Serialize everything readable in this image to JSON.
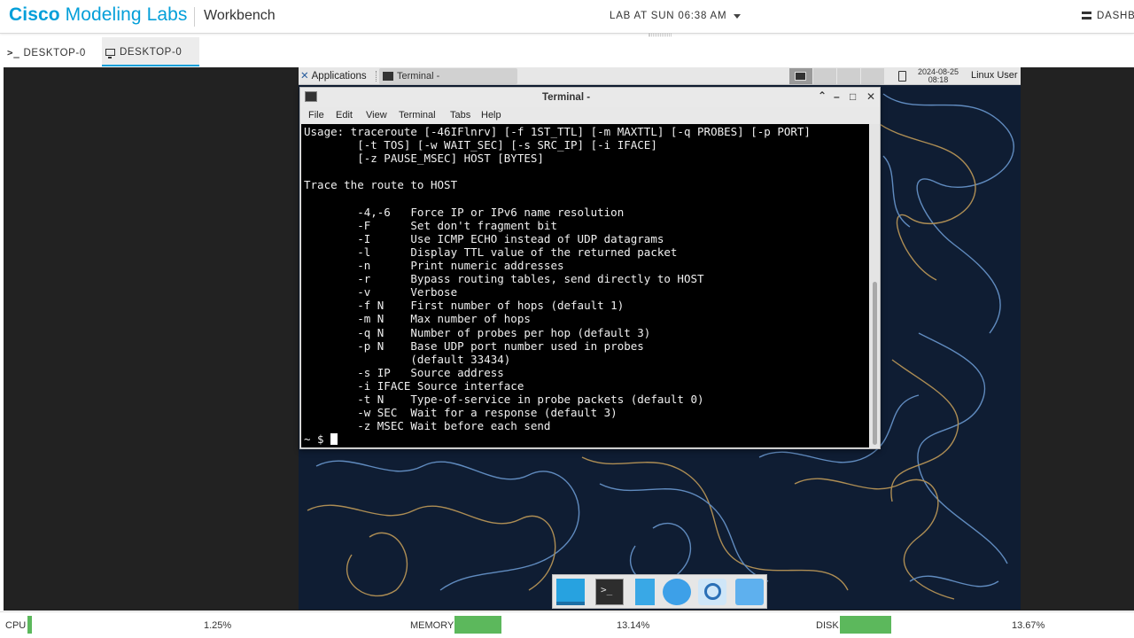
{
  "header": {
    "brand_bold": "Cisco",
    "brand_rest": "Modeling Labs",
    "section": "Workbench",
    "lab_name": "LAB AT SUN 06:38 AM",
    "dashboard": "DASHB"
  },
  "tabs": [
    {
      "label": "DESKTOP-0",
      "icon": "terminal-prompt-icon",
      "active": false
    },
    {
      "label": "DESKTOP-0",
      "icon": "monitor-icon",
      "active": true
    }
  ],
  "xfce_panel": {
    "applications": "Applications",
    "task_title": "Terminal -",
    "clock_date": "2024-08-25",
    "clock_time": "08:18",
    "user": "Linux User"
  },
  "terminal": {
    "title": "Terminal -",
    "menu": [
      "File",
      "Edit",
      "View",
      "Terminal",
      "Tabs",
      "Help"
    ],
    "lines": [
      "Usage: traceroute [-46IFlnrv] [-f 1ST_TTL] [-m MAXTTL] [-q PROBES] [-p PORT]",
      "        [-t TOS] [-w WAIT_SEC] [-s SRC_IP] [-i IFACE]",
      "        [-z PAUSE_MSEC] HOST [BYTES]",
      "",
      "Trace the route to HOST",
      "",
      "        -4,-6   Force IP or IPv6 name resolution",
      "        -F      Set don't fragment bit",
      "        -I      Use ICMP ECHO instead of UDP datagrams",
      "        -l      Display TTL value of the returned packet",
      "        -n      Print numeric addresses",
      "        -r      Bypass routing tables, send directly to HOST",
      "        -v      Verbose",
      "        -f N    First number of hops (default 1)",
      "        -m N    Max number of hops",
      "        -q N    Number of probes per hop (default 3)",
      "        -p N    Base UDP port number used in probes",
      "                (default 33434)",
      "        -s IP   Source address",
      "        -i IFACE Source interface",
      "        -t N    Type-of-service in probe packets (default 0)",
      "        -w SEC  Wait for a response (default 3)",
      "        -z MSEC Wait before each send"
    ],
    "prompt": "~ $ "
  },
  "dock": [
    "show-desktop-icon",
    "terminal-icon",
    "file-manager-icon",
    "web-browser-icon",
    "app-finder-icon",
    "folder-icon"
  ],
  "status": {
    "cpu_label": "CPU",
    "cpu_value": "1.25%",
    "cpu_fraction": 0.0125,
    "memory_label": "MEMORY",
    "memory_value": "13.14%",
    "memory_fraction": 0.1314,
    "disk_label": "DISK",
    "disk_value": "13.67%",
    "disk_fraction": 0.1367
  },
  "colors": {
    "brand": "#049fd9",
    "meter": "#5cb85c",
    "desktop_bg": "#0f1d33",
    "terminal_bg": "#000000"
  }
}
